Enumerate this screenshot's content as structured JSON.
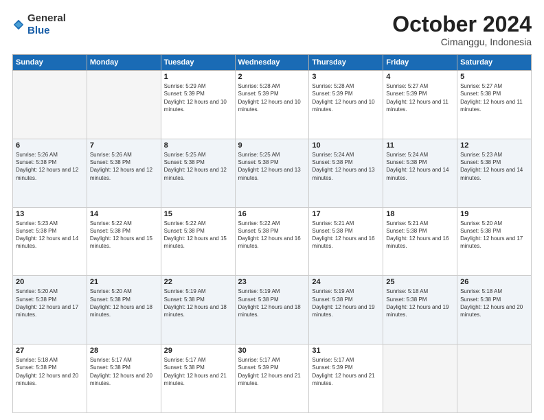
{
  "header": {
    "logo_general": "General",
    "logo_blue": "Blue",
    "month_title": "October 2024",
    "subtitle": "Cimanggu, Indonesia"
  },
  "weekdays": [
    "Sunday",
    "Monday",
    "Tuesday",
    "Wednesday",
    "Thursday",
    "Friday",
    "Saturday"
  ],
  "weeks": [
    [
      {
        "day": "",
        "empty": true
      },
      {
        "day": "",
        "empty": true
      },
      {
        "day": "1",
        "sunrise": "5:29 AM",
        "sunset": "5:39 PM",
        "daylight": "12 hours and 10 minutes."
      },
      {
        "day": "2",
        "sunrise": "5:28 AM",
        "sunset": "5:39 PM",
        "daylight": "12 hours and 10 minutes."
      },
      {
        "day": "3",
        "sunrise": "5:28 AM",
        "sunset": "5:39 PM",
        "daylight": "12 hours and 10 minutes."
      },
      {
        "day": "4",
        "sunrise": "5:27 AM",
        "sunset": "5:39 PM",
        "daylight": "12 hours and 11 minutes."
      },
      {
        "day": "5",
        "sunrise": "5:27 AM",
        "sunset": "5:38 PM",
        "daylight": "12 hours and 11 minutes."
      }
    ],
    [
      {
        "day": "6",
        "sunrise": "5:26 AM",
        "sunset": "5:38 PM",
        "daylight": "12 hours and 12 minutes."
      },
      {
        "day": "7",
        "sunrise": "5:26 AM",
        "sunset": "5:38 PM",
        "daylight": "12 hours and 12 minutes."
      },
      {
        "day": "8",
        "sunrise": "5:25 AM",
        "sunset": "5:38 PM",
        "daylight": "12 hours and 12 minutes."
      },
      {
        "day": "9",
        "sunrise": "5:25 AM",
        "sunset": "5:38 PM",
        "daylight": "12 hours and 13 minutes."
      },
      {
        "day": "10",
        "sunrise": "5:24 AM",
        "sunset": "5:38 PM",
        "daylight": "12 hours and 13 minutes."
      },
      {
        "day": "11",
        "sunrise": "5:24 AM",
        "sunset": "5:38 PM",
        "daylight": "12 hours and 14 minutes."
      },
      {
        "day": "12",
        "sunrise": "5:23 AM",
        "sunset": "5:38 PM",
        "daylight": "12 hours and 14 minutes."
      }
    ],
    [
      {
        "day": "13",
        "sunrise": "5:23 AM",
        "sunset": "5:38 PM",
        "daylight": "12 hours and 14 minutes."
      },
      {
        "day": "14",
        "sunrise": "5:22 AM",
        "sunset": "5:38 PM",
        "daylight": "12 hours and 15 minutes."
      },
      {
        "day": "15",
        "sunrise": "5:22 AM",
        "sunset": "5:38 PM",
        "daylight": "12 hours and 15 minutes."
      },
      {
        "day": "16",
        "sunrise": "5:22 AM",
        "sunset": "5:38 PM",
        "daylight": "12 hours and 16 minutes."
      },
      {
        "day": "17",
        "sunrise": "5:21 AM",
        "sunset": "5:38 PM",
        "daylight": "12 hours and 16 minutes."
      },
      {
        "day": "18",
        "sunrise": "5:21 AM",
        "sunset": "5:38 PM",
        "daylight": "12 hours and 16 minutes."
      },
      {
        "day": "19",
        "sunrise": "5:20 AM",
        "sunset": "5:38 PM",
        "daylight": "12 hours and 17 minutes."
      }
    ],
    [
      {
        "day": "20",
        "sunrise": "5:20 AM",
        "sunset": "5:38 PM",
        "daylight": "12 hours and 17 minutes."
      },
      {
        "day": "21",
        "sunrise": "5:20 AM",
        "sunset": "5:38 PM",
        "daylight": "12 hours and 18 minutes."
      },
      {
        "day": "22",
        "sunrise": "5:19 AM",
        "sunset": "5:38 PM",
        "daylight": "12 hours and 18 minutes."
      },
      {
        "day": "23",
        "sunrise": "5:19 AM",
        "sunset": "5:38 PM",
        "daylight": "12 hours and 18 minutes."
      },
      {
        "day": "24",
        "sunrise": "5:19 AM",
        "sunset": "5:38 PM",
        "daylight": "12 hours and 19 minutes."
      },
      {
        "day": "25",
        "sunrise": "5:18 AM",
        "sunset": "5:38 PM",
        "daylight": "12 hours and 19 minutes."
      },
      {
        "day": "26",
        "sunrise": "5:18 AM",
        "sunset": "5:38 PM",
        "daylight": "12 hours and 20 minutes."
      }
    ],
    [
      {
        "day": "27",
        "sunrise": "5:18 AM",
        "sunset": "5:38 PM",
        "daylight": "12 hours and 20 minutes."
      },
      {
        "day": "28",
        "sunrise": "5:17 AM",
        "sunset": "5:38 PM",
        "daylight": "12 hours and 20 minutes."
      },
      {
        "day": "29",
        "sunrise": "5:17 AM",
        "sunset": "5:38 PM",
        "daylight": "12 hours and 21 minutes."
      },
      {
        "day": "30",
        "sunrise": "5:17 AM",
        "sunset": "5:39 PM",
        "daylight": "12 hours and 21 minutes."
      },
      {
        "day": "31",
        "sunrise": "5:17 AM",
        "sunset": "5:39 PM",
        "daylight": "12 hours and 21 minutes."
      },
      {
        "day": "",
        "empty": true
      },
      {
        "day": "",
        "empty": true
      }
    ]
  ]
}
